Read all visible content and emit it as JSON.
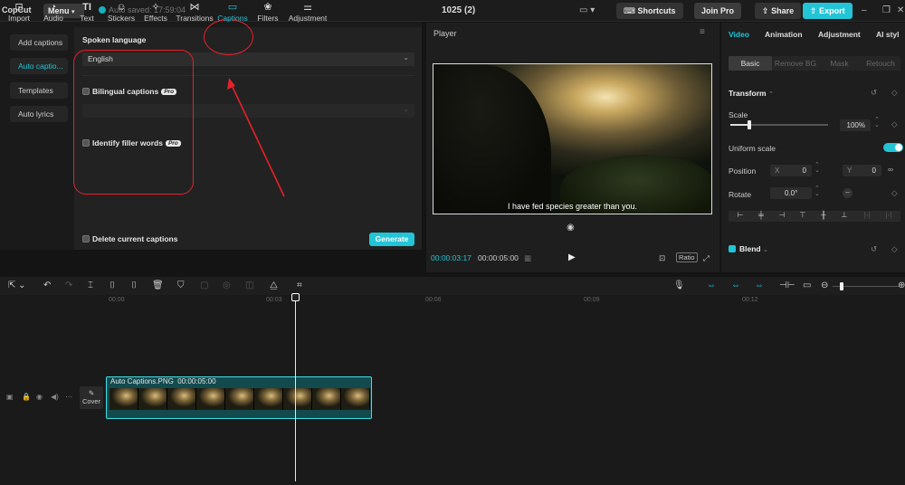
{
  "titlebar": {
    "logo": "CopCut",
    "menu": "Menu",
    "autosave": "Auto saved: 17:59:04",
    "project": "1025 (2)",
    "shortcuts": "Shortcuts",
    "join_pro": "Join Pro",
    "share": "Share",
    "export": "Export"
  },
  "tool_tabs": [
    "Import",
    "Audio",
    "Text",
    "Stickers",
    "Effects",
    "Transitions",
    "Captions",
    "Filters",
    "Adjustment"
  ],
  "sidebar": [
    "Add captions",
    "Auto captio...",
    "Templates",
    "Auto lyrics"
  ],
  "captions": {
    "spoken_language_label": "Spoken language",
    "language": "English",
    "bilingual": "Bilingual captions",
    "identify_filler": "Identify filler words",
    "pro": "Pro",
    "delete_captions": "Delete current captions",
    "generate": "Generate"
  },
  "player": {
    "title": "Player",
    "subtitle": "I have fed species greater than you.",
    "current_time": "00:00:03:17",
    "total_time": "00:00:05:00",
    "ratio": "Ratio"
  },
  "props": {
    "tabs": [
      "Video",
      "Animation",
      "Adjustment",
      "AI styl"
    ],
    "subtabs": [
      "Basic",
      "Remove BG",
      "Mask",
      "Retouch"
    ],
    "transform": "Transform",
    "scale_label": "Scale",
    "scale_value": "100%",
    "uniform_scale": "Uniform scale",
    "position_label": "Position",
    "pos_x_axis": "X",
    "pos_x": "0",
    "pos_y_axis": "Y",
    "pos_y": "0",
    "rotate_label": "Rotate",
    "rotate_value": "0.0°",
    "blend": "Blend"
  },
  "timeline": {
    "ruler": [
      "00:00",
      "00:03",
      "00:06",
      "00:09",
      "00:12"
    ],
    "clip_name": "Auto Captions.PNG",
    "clip_duration": "00:00:05:00",
    "cover": "Cover"
  },
  "colors": {
    "accent": "#23c4d6",
    "annotation": "#e8202a"
  }
}
